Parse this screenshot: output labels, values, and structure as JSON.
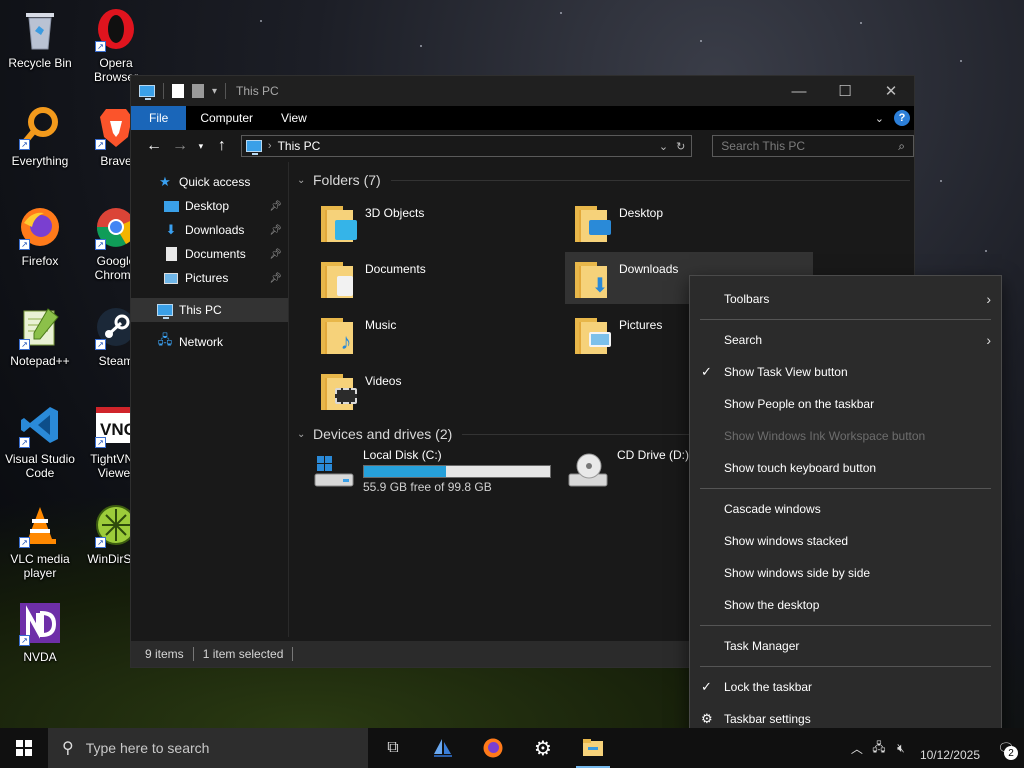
{
  "desktop": {
    "icons": [
      {
        "label": "Recycle Bin"
      },
      {
        "label": "Everything"
      },
      {
        "label": "Firefox"
      },
      {
        "label": "Notepad++"
      },
      {
        "label": "Visual Studio Code"
      },
      {
        "label": "VLC media player"
      },
      {
        "label": "NVDA"
      },
      {
        "label": "Opera Browser"
      },
      {
        "label": "Brave"
      },
      {
        "label": "Google Chrome"
      },
      {
        "label": "Steam"
      },
      {
        "label": "TightVNC Viewer"
      },
      {
        "label": "WinDirStat"
      }
    ]
  },
  "explorer": {
    "title": "This PC",
    "ribbon_tabs": [
      "File",
      "Computer",
      "View"
    ],
    "address_crumb": "This PC",
    "search_placeholder": "Search This PC",
    "nav_pane": {
      "quick_access": "Quick access",
      "pinned": [
        "Desktop",
        "Downloads",
        "Documents",
        "Pictures"
      ],
      "this_pc": "This PC",
      "network": "Network"
    },
    "folders_header": "Folders (7)",
    "folders": [
      "3D Objects",
      "Desktop",
      "Documents",
      "Downloads",
      "Music",
      "Pictures",
      "Videos"
    ],
    "devices_header": "Devices and drives (2)",
    "drives": [
      {
        "name": "Local Disk (C:)",
        "free_text": "55.9 GB free of 99.8 GB",
        "used_fraction": 0.44
      },
      {
        "name": "CD Drive (D:)"
      }
    ],
    "status": {
      "items": "9 items",
      "selected": "1 item selected"
    }
  },
  "context_menu": {
    "toolbars": "Toolbars",
    "search": "Search",
    "show_task_view": "Show Task View button",
    "show_people": "Show People on the taskbar",
    "show_ink": "Show Windows Ink Workspace button",
    "show_touch_keyboard": "Show touch keyboard button",
    "cascade": "Cascade windows",
    "stacked": "Show windows stacked",
    "side_by_side": "Show windows side by side",
    "show_desktop": "Show the desktop",
    "task_manager": "Task Manager",
    "lock_taskbar": "Lock the taskbar",
    "taskbar_settings": "Taskbar settings"
  },
  "taskbar": {
    "search_placeholder": "Type here to search",
    "clock_date": "10/12/2025",
    "notification_count": "2"
  },
  "colors": {
    "accent": "#1a66b9",
    "drive_bar": "#26a0da",
    "folder": "#f6d27a"
  }
}
